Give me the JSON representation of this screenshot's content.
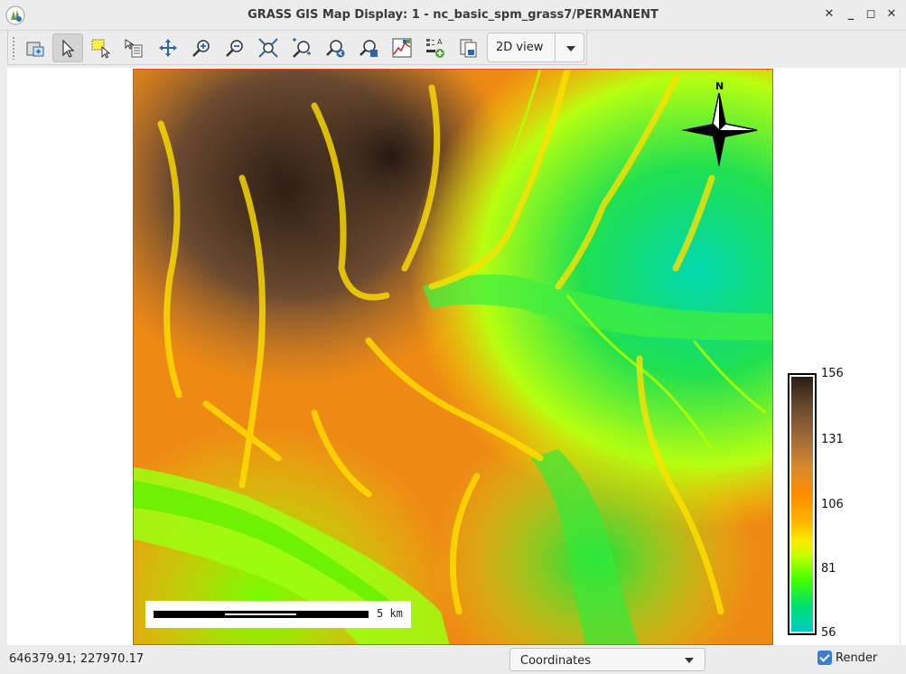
{
  "window": {
    "title": "GRASS GIS Map Display: 1 - nc_basic_spm_grass7/PERMANENT",
    "controls": [
      "close",
      "minimize",
      "maximize",
      "close"
    ]
  },
  "toolbar": {
    "tools": [
      {
        "name": "display-map-icon",
        "active": false
      },
      {
        "name": "pointer-icon",
        "active": true
      },
      {
        "name": "select-vector-icon",
        "active": false
      },
      {
        "name": "query-icon",
        "active": false
      },
      {
        "name": "pan-icon",
        "active": false
      },
      {
        "name": "zoom-in-icon",
        "active": false
      },
      {
        "name": "zoom-out-icon",
        "active": false
      },
      {
        "name": "zoom-extent-icon",
        "active": false
      },
      {
        "name": "zoom-region-icon",
        "active": false
      },
      {
        "name": "zoom-back-icon",
        "active": false
      },
      {
        "name": "zoom-menu-icon",
        "active": false
      },
      {
        "name": "analyze-icon",
        "active": false
      },
      {
        "name": "decoration-icon",
        "active": false
      },
      {
        "name": "save-image-icon",
        "active": false
      }
    ],
    "view_mode": "2D view"
  },
  "map": {
    "north_label": "N",
    "scale_label": "5 km"
  },
  "legend": {
    "ticks": [
      "156",
      "131",
      "106",
      "81",
      "56"
    ]
  },
  "status": {
    "coordinates": "646379.91; 227970.17",
    "mode": "Coordinates",
    "render_label": "Render",
    "render_checked": true
  }
}
